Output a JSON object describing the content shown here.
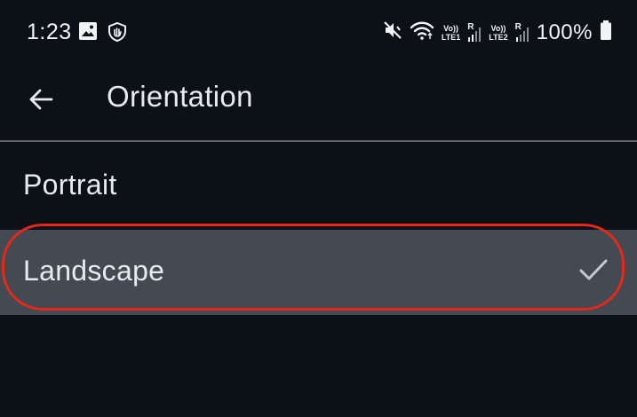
{
  "status_bar": {
    "time": "1:23",
    "left_icons": [
      "image-icon",
      "shield-hand-icon"
    ],
    "right_icons": [
      "mute-vibrate-icon",
      "wifi-icon",
      "volte-lte1-icon",
      "signal-r-icon",
      "volte-lte2-icon",
      "signal-r-icon",
      "battery-icon"
    ],
    "sim1_top": "Vo))",
    "sim1_bottom": "LTE1",
    "sim2_top": "Vo))",
    "sim2_bottom": "LTE2",
    "roaming": "R",
    "battery_percent": "100%"
  },
  "app_bar": {
    "back_icon": "arrow-back-icon",
    "title": "Orientation"
  },
  "options": [
    {
      "label": "Portrait",
      "selected": false
    },
    {
      "label": "Landscape",
      "selected": true
    }
  ],
  "annotation": {
    "highlight_color": "#e8271b",
    "highlighted_option": "Landscape"
  },
  "colors": {
    "background": "#0c1117",
    "selected_row": "#434a52",
    "text": "#e8eaed",
    "divider": "#5f6368"
  }
}
